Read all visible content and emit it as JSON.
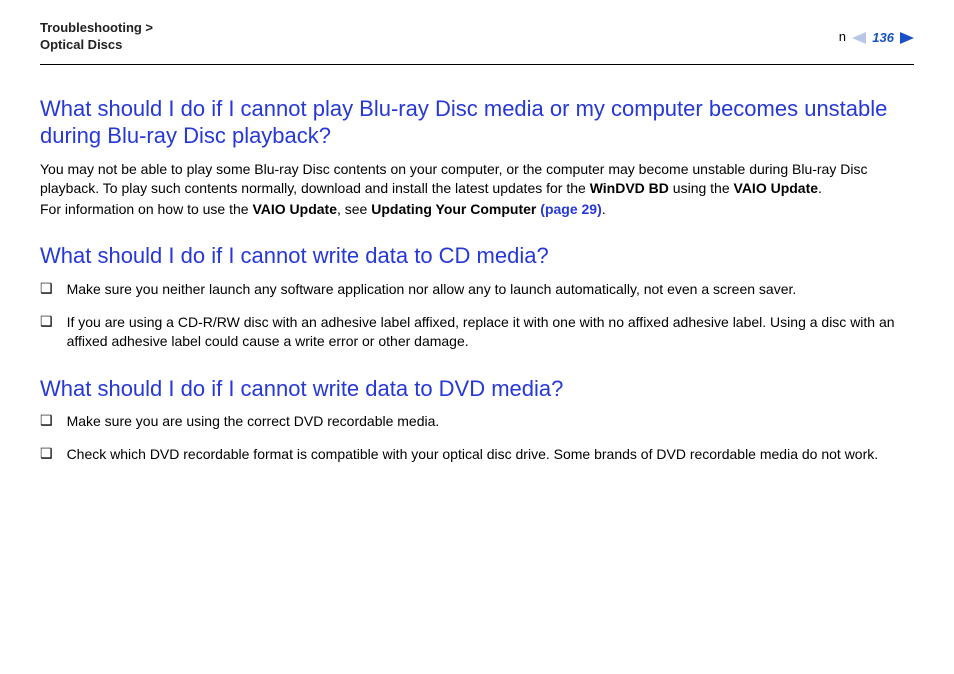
{
  "header": {
    "breadcrumb_line1": "Troubleshooting >",
    "breadcrumb_line2": "Optical Discs",
    "page_number": "136",
    "n_label": "n"
  },
  "section1": {
    "heading": "What should I do if I cannot play Blu-ray Disc media or my computer becomes unstable during Blu-ray Disc playback?",
    "para1_part1": "You may not be able to play some Blu-ray Disc contents on your computer, or the computer may become unstable during Blu-ray Disc playback. To play such contents normally, download and install the latest updates for the ",
    "para1_bold1": "WinDVD BD",
    "para1_part2": " using the ",
    "para1_bold2": "VAIO Update",
    "para1_part3": ".",
    "para2_part1": "For information on how to use the ",
    "para2_bold1": "VAIO Update",
    "para2_part2": ", see ",
    "para2_bold2": "Updating Your Computer",
    "para2_link": " (page 29)",
    "para2_part3": "."
  },
  "section2": {
    "heading": "What should I do if I cannot write data to CD media?",
    "items": [
      "Make sure you neither launch any software application nor allow any to launch automatically, not even a screen saver.",
      "If you are using a CD-R/RW disc with an adhesive label affixed, replace it with one with no affixed adhesive label. Using a disc with an affixed adhesive label could cause a write error or other damage."
    ]
  },
  "section3": {
    "heading": "What should I do if I cannot write data to DVD media?",
    "items": [
      "Make sure you are using the correct DVD recordable media.",
      "Check which DVD recordable format is compatible with your optical disc drive. Some brands of DVD recordable media do not work."
    ]
  },
  "glyphs": {
    "bullet": "❑"
  }
}
